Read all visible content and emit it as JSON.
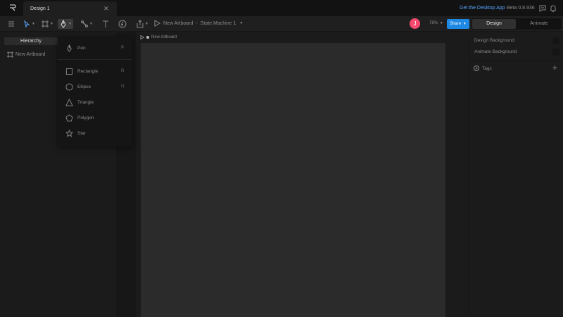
{
  "titlebar": {
    "tab_title": "Design 1",
    "close_glyph": "✕",
    "desktop_link": "Get the Desktop App",
    "version": "Beta 0.8.936"
  },
  "toolbar": {
    "breadcrumb_artboard": "New Artboard",
    "breadcrumb_separator": "-",
    "breadcrumb_state": "State Machine 1",
    "avatar_initial": "J",
    "zoom": "78%",
    "share_label": "Share",
    "mode_design": "Design",
    "mode_animate": "Animate"
  },
  "left_panel": {
    "tab_label": "Hierarchy",
    "items": [
      {
        "label": "New Artboard"
      }
    ]
  },
  "canvas": {
    "artboard_label": "New Artboard"
  },
  "right_panel": {
    "design_background": "Design Background",
    "animate_background": "Animate Background",
    "tags_label": "Tags",
    "plus": "+"
  },
  "menu": {
    "items": [
      {
        "label": "Pen",
        "key": "P"
      },
      {
        "label": "Rectangle",
        "key": "R"
      },
      {
        "label": "Ellipse",
        "key": "O"
      },
      {
        "label": "Triangle",
        "key": ""
      },
      {
        "label": "Polygon",
        "key": ""
      },
      {
        "label": "Star",
        "key": ""
      }
    ]
  },
  "colors": {
    "accent": "#1e88e5",
    "link": "#57a5ff",
    "avatar": "#f64a6f"
  }
}
